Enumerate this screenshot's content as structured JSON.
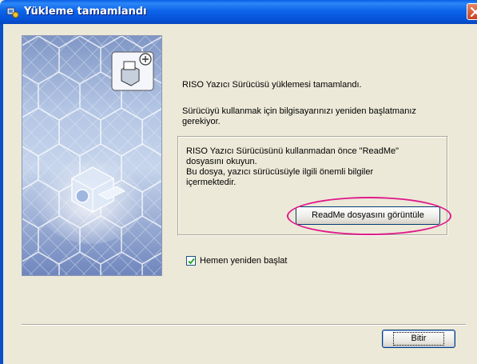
{
  "window": {
    "title": "Yükleme tamamlandı",
    "title_icon": "setup-wizard-icon",
    "close_icon": "close-icon"
  },
  "content": {
    "message_line1": "RISO Yazıcı Sürücüsü yüklemesi tamamlandı.",
    "message_line2a": "Sürücüyü kullanmak için bilgisayarınızı yeniden başlatmanız",
    "message_line2b": "gerekiyor."
  },
  "readme_group": {
    "line1": "RISO Yazıcı Sürücüsünü kullanmadan önce \"ReadMe\"",
    "line2": "dosyasını okuyun.",
    "line3": "Bu dosya, yazıcı sürücüsüyle ilgili önemli bilgiler",
    "line4": "içermektedir.",
    "button_label": "ReadMe dosyasını görüntüle"
  },
  "restart_option": {
    "label": "Hemen yeniden başlat",
    "checked": true
  },
  "footer": {
    "finish_label": "Bitir"
  },
  "colors": {
    "titlebar": "#0A5FE4",
    "dialog_background": "#ECE9D8",
    "highlight_ellipse": "#E0198A"
  }
}
